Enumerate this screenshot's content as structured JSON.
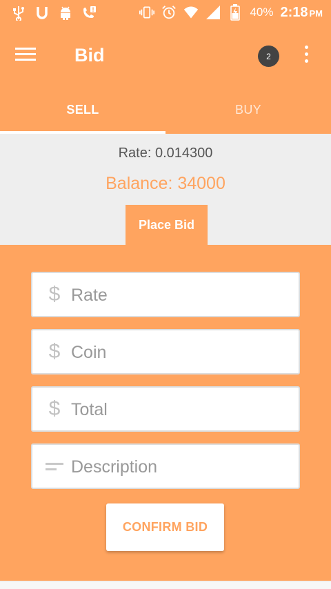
{
  "status_bar": {
    "left_icons": [
      "usb-icon",
      "u-icon",
      "android-icon",
      "phone-alert-icon"
    ],
    "right_icons": [
      "vibrate-icon",
      "alarm-icon",
      "wifi-icon",
      "signal-icon",
      "battery-icon"
    ],
    "battery": "40%",
    "time": "2:18",
    "ampm": "PM"
  },
  "toolbar": {
    "title": "Bid",
    "badge_count": "2"
  },
  "tabs": [
    {
      "label": "SELL",
      "active": true
    },
    {
      "label": "BUY",
      "active": false
    }
  ],
  "info": {
    "rate": "Rate: 0.014300",
    "balance": "Balance: 34000",
    "place_bid": "Place Bid"
  },
  "form": {
    "rate_placeholder": "Rate",
    "coin_placeholder": "Coin",
    "total_placeholder": "Total",
    "description_placeholder": "Description",
    "confirm_label": "CONFIRM BID"
  },
  "colors": {
    "primary": "#ffa45f",
    "info_background": "#eeeeee",
    "badge": "#434343"
  }
}
